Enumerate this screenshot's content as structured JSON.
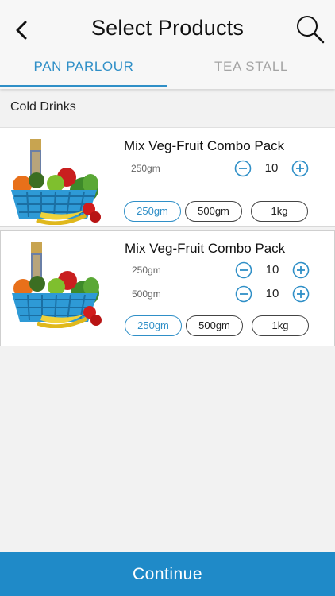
{
  "header": {
    "title": "Select Products",
    "back_icon": "chevron-left-icon",
    "search_icon": "search-icon"
  },
  "tabs": [
    {
      "label": "PAN PARLOUR",
      "active": true
    },
    {
      "label": "TEA STALL",
      "active": false
    }
  ],
  "section": {
    "label": "Cold Drinks"
  },
  "products": [
    {
      "name": "Mix Veg-Fruit Combo Pack",
      "image": "fruit-basket-image",
      "variants": [
        {
          "label": "250gm",
          "quantity": "10"
        }
      ],
      "sizes": [
        "250gm",
        "500gm",
        "1kg"
      ],
      "selected_size": "250gm"
    },
    {
      "name": "Mix Veg-Fruit Combo Pack",
      "image": "fruit-basket-image",
      "variants": [
        {
          "label": "250gm",
          "quantity": "10"
        },
        {
          "label": "500gm",
          "quantity": "10"
        }
      ],
      "sizes": [
        "250gm",
        "500gm",
        "1kg"
      ],
      "selected_size": "250gm"
    }
  ],
  "footer": {
    "continue_label": "Continue"
  },
  "colors": {
    "accent": "#2f8fc7",
    "continue_bg": "#1f8ac8",
    "background": "#f2f2f2"
  }
}
